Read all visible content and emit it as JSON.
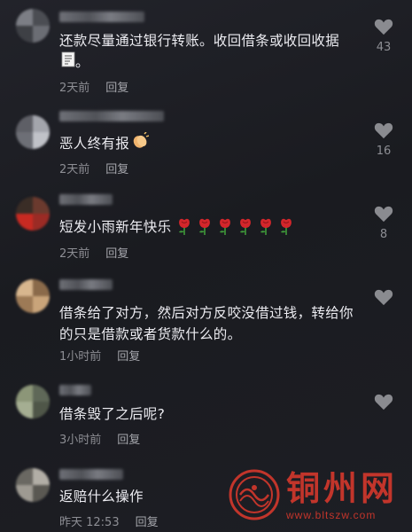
{
  "comments": [
    {
      "text": "还款尽量通过银行转账。收回借条或收回收据",
      "text2": "。",
      "time": "2天前",
      "reply": "回复",
      "likes": "43",
      "emoji": "receipt"
    },
    {
      "text": "恶人终有报",
      "time": "2天前",
      "reply": "回复",
      "likes": "16",
      "emoji": "clap"
    },
    {
      "text": "短发小雨新年快乐",
      "time": "2天前",
      "reply": "回复",
      "likes": "8",
      "emoji": "rose",
      "emoji_count": 6
    },
    {
      "text": "借条给了对方，然后对方反咬没借过钱，转给你的只是借款或者货款什么的。",
      "time": "1小时前",
      "reply": "回复",
      "likes": ""
    },
    {
      "text": "借条毁了之后呢?",
      "time": "3小时前",
      "reply": "回复",
      "likes": ""
    },
    {
      "text": "返赔什么操作",
      "time": "昨天 12:53",
      "reply": "回复",
      "likes": ""
    }
  ],
  "watermark": {
    "title": "铜州网",
    "url": "www.bltszw.com"
  },
  "colors": {
    "background": "#1c1d22",
    "text": "#ececf1",
    "meta": "#8d8e94",
    "heart": "#8a8b90",
    "watermark": "#c2352b"
  }
}
